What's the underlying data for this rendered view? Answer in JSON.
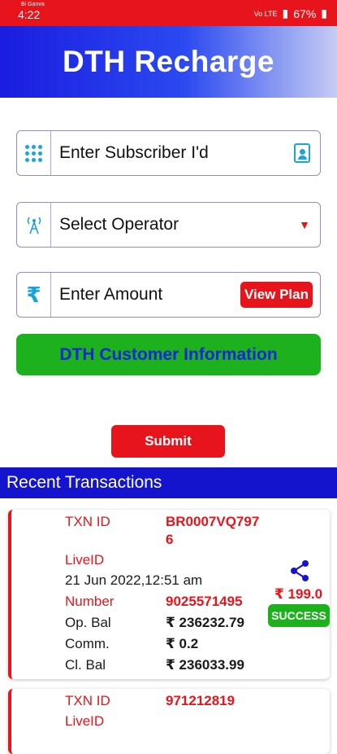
{
  "status_bar": {
    "time": "4:22",
    "carrier": "Bi Ganva",
    "indicators": "Vo LTE",
    "battery": "67%"
  },
  "header": {
    "title": "DTH Recharge"
  },
  "form": {
    "subscriber_placeholder": "Enter Subscriber I'd",
    "operator_placeholder": "Select Operator",
    "amount_placeholder": "Enter Amount",
    "view_plan_label": "View Plan",
    "customer_info_label": "DTH Customer Information",
    "submit_label": "Submit"
  },
  "recent": {
    "title": "Recent Transactions",
    "transactions": [
      {
        "txn_label": "TXN ID",
        "txn_id_line1": "BR0007VQ797",
        "txn_id_line2": "6",
        "live_label": "LiveID",
        "date": "21 Jun 2022,12:51 am",
        "number_label": "Number",
        "number": "9025571495",
        "opbal_label": "Op. Bal",
        "opbal": "₹ 236232.79",
        "comm_label": "Comm.",
        "comm": "₹ 0.2",
        "clbal_label": "Cl. Bal",
        "clbal": "₹ 236033.99",
        "amount": "₹ 199.0",
        "status": "SUCCESS"
      },
      {
        "txn_label": "TXN ID",
        "txn_id_line1": "971212819",
        "live_label": "LiveID"
      }
    ]
  },
  "colors": {
    "primary_red": "#e8141c",
    "primary_blue": "#1414ce",
    "success_green": "#1eb11e",
    "icon_cyan": "#16a7d9"
  }
}
